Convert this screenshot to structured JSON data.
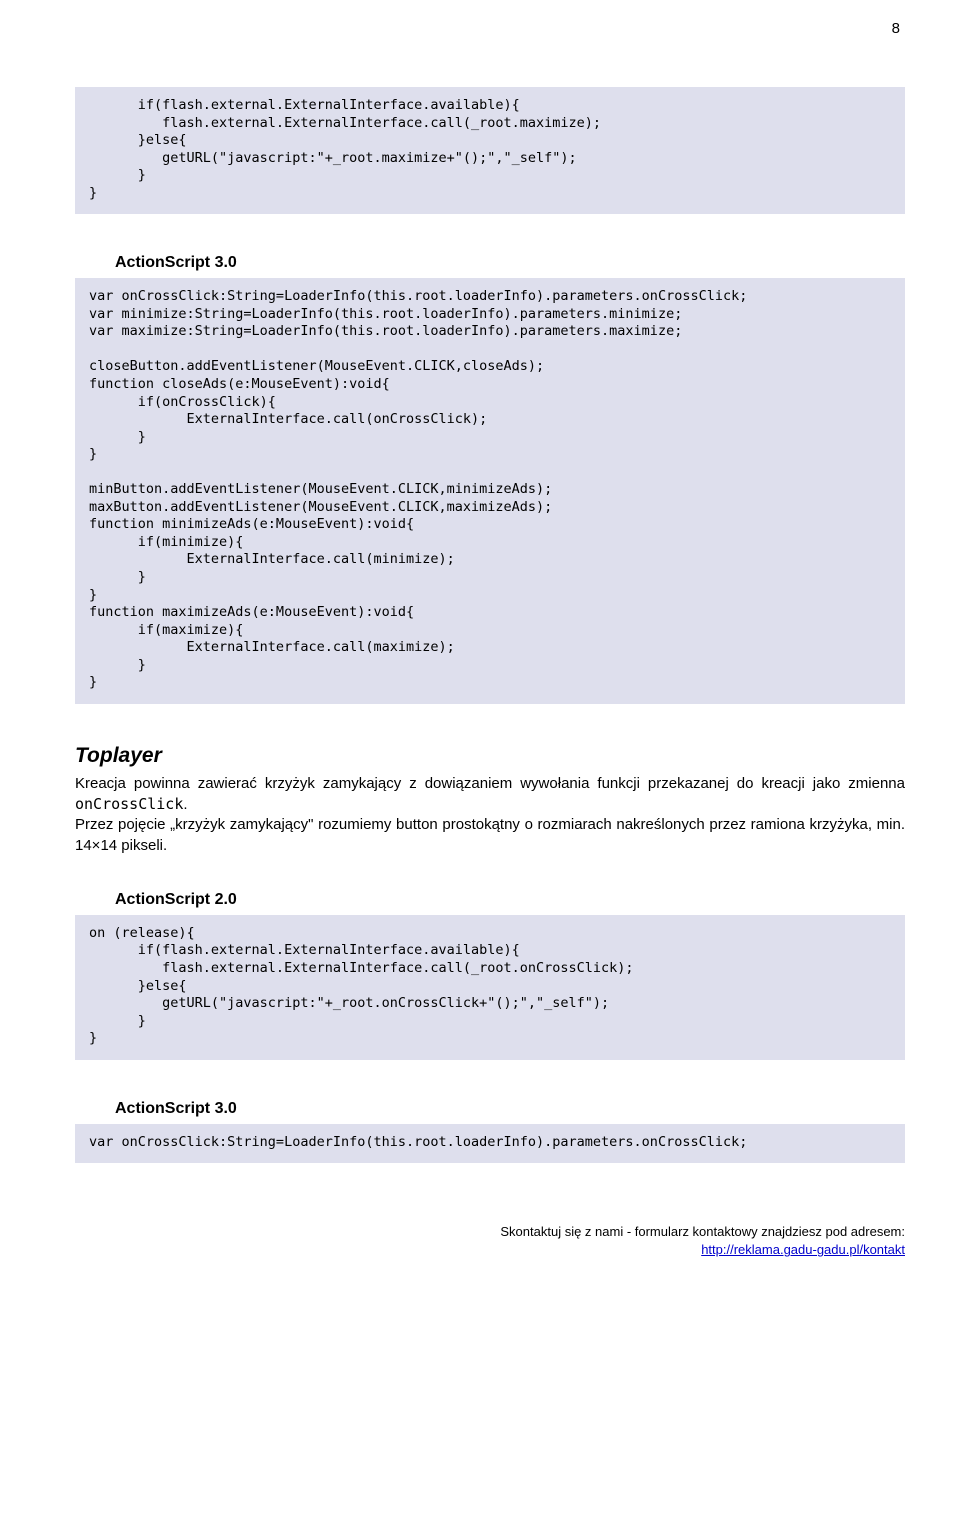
{
  "page_number": "8",
  "code_block_1": "      if(flash.external.ExternalInterface.available){\n         flash.external.ExternalInterface.call(_root.maximize);\n      }else{\n         getURL(\"javascript:\"+_root.maximize+\"();\",\"_self\");\n      }\n}",
  "heading_as3": "ActionScript 3.0",
  "code_block_2": "var onCrossClick:String=LoaderInfo(this.root.loaderInfo).parameters.onCrossClick;\nvar minimize:String=LoaderInfo(this.root.loaderInfo).parameters.minimize;\nvar maximize:String=LoaderInfo(this.root.loaderInfo).parameters.maximize;\n\ncloseButton.addEventListener(MouseEvent.CLICK,closeAds);\nfunction closeAds(e:MouseEvent):void{\n      if(onCrossClick){\n            ExternalInterface.call(onCrossClick);\n      }\n}\n\nminButton.addEventListener(MouseEvent.CLICK,minimizeAds);\nmaxButton.addEventListener(MouseEvent.CLICK,maximizeAds);\nfunction minimizeAds(e:MouseEvent):void{\n      if(minimize){\n            ExternalInterface.call(minimize);\n      }\n}\nfunction maximizeAds(e:MouseEvent):void{\n      if(maximize){\n            ExternalInterface.call(maximize);\n      }\n}",
  "toplayer_title": "Toplayer",
  "toplayer_p1": "Kreacja powinna zawierać krzyżyk zamykający z dowiązaniem wywołania funkcji przekazanej do kreacji jako zmienna",
  "toplayer_mono": "onCrossClick",
  "toplayer_p2": "Przez pojęcie „krzyżyk zamykający\" rozumiemy button prostokątny o rozmiarach nakreślonych przez ramiona krzyżyka, min. 14×14 pikseli.",
  "heading_as2": "ActionScript 2.0",
  "code_block_3": "on (release){\n      if(flash.external.ExternalInterface.available){\n         flash.external.ExternalInterface.call(_root.onCrossClick);\n      }else{\n         getURL(\"javascript:\"+_root.onCrossClick+\"();\",\"_self\");\n      }\n}",
  "heading_as3_2": "ActionScript 3.0",
  "code_block_4": "var onCrossClick:String=LoaderInfo(this.root.loaderInfo).parameters.onCrossClick;",
  "footer_line1": "Skontaktuj się z nami - formularz kontaktowy znajdziesz pod adresem:",
  "footer_link": "http://reklama.gadu-gadu.pl/kontakt"
}
